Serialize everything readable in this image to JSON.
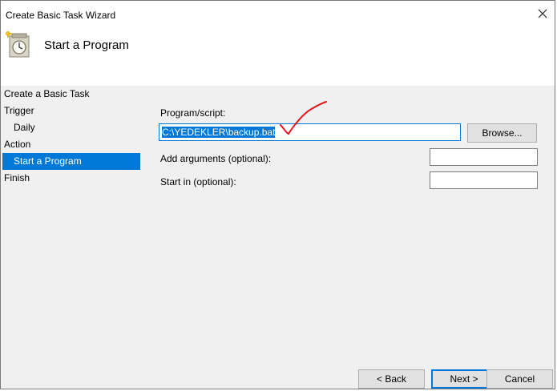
{
  "window": {
    "title": "Create Basic Task Wizard",
    "close_symbol": "✕"
  },
  "header": {
    "title": "Start a Program",
    "icon": "task-scheduler-clock-icon"
  },
  "sidebar": {
    "items": [
      {
        "label": "Create a Basic Task",
        "indent": false,
        "active": false
      },
      {
        "label": "Trigger",
        "indent": false,
        "active": false
      },
      {
        "label": "Daily",
        "indent": true,
        "active": false
      },
      {
        "label": "Action",
        "indent": false,
        "active": false
      },
      {
        "label": "Start a Program",
        "indent": true,
        "active": true
      },
      {
        "label": "Finish",
        "indent": false,
        "active": false
      }
    ]
  },
  "form": {
    "program_label": "Program/script:",
    "program_value": "C:\\YEDEKLER\\backup.bat",
    "browse_label": "Browse...",
    "arguments_label": "Add arguments (optional):",
    "arguments_value": "",
    "start_in_label": "Start in (optional):",
    "start_in_value": ""
  },
  "footer": {
    "back_label": "< Back",
    "next_label": "Next >",
    "cancel_label": "Cancel"
  },
  "colors": {
    "accent": "#0078d7",
    "annotation": "#e8141c"
  }
}
